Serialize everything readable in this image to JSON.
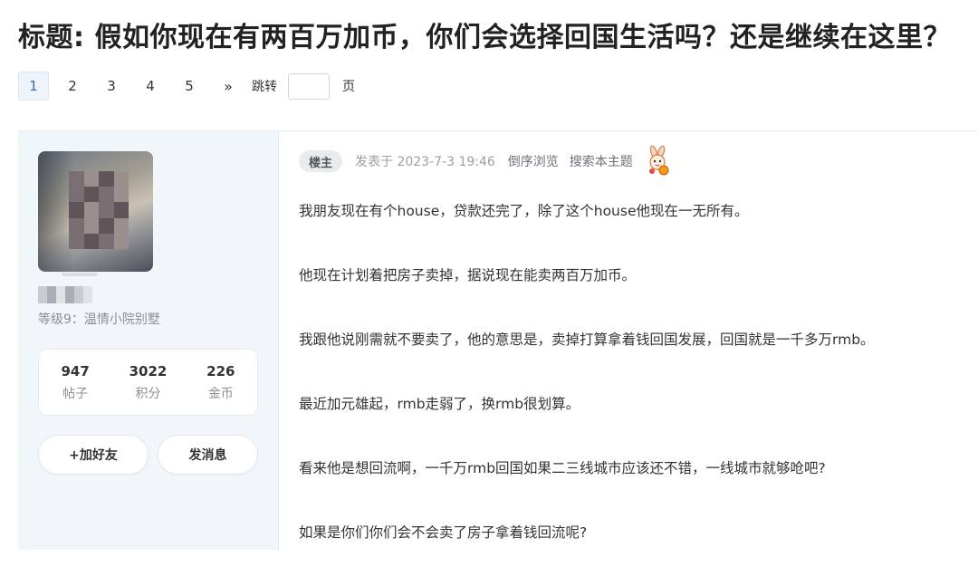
{
  "thread": {
    "title": "标题: 假如你现在有两百万加币，你们会选择回国生活吗？还是继续在这里？"
  },
  "pagination": {
    "pages": [
      "1",
      "2",
      "3",
      "4",
      "5"
    ],
    "current": "1",
    "next": "»",
    "jump_label": "跳转",
    "jump_value": "",
    "page_unit": "页"
  },
  "author": {
    "level": "等级9：温情小院别墅",
    "stats": [
      {
        "value": "947",
        "label": "帖子"
      },
      {
        "value": "3022",
        "label": "积分"
      },
      {
        "value": "226",
        "label": "金币"
      }
    ],
    "add_friend": "+加好友",
    "send_message": "发消息"
  },
  "post": {
    "owner_badge": "楼主",
    "posted_at": "发表于 2023-7-3 19:46",
    "reverse_view": "倒序浏览",
    "search_thread": "搜索本主题",
    "mascot_icon": "rabbit-mascot-icon",
    "paragraphs": [
      "我朋友现在有个house，贷款还完了，除了这个house他现在一无所有。",
      "他现在计划着把房子卖掉，据说现在能卖两百万加币。",
      "我跟他说刚需就不要卖了，他的意思是，卖掉打算拿着钱回国发展，回国就是一千多万rmb。",
      "最近加元雄起，rmb走弱了，换rmb很划算。",
      "看来他是想回流啊，一千万rmb回国如果二三线城市应该还不错，一线城市就够呛吧?",
      "如果是你们你们会不会卖了房子拿着钱回流呢?"
    ]
  },
  "colors": {
    "sidebar_bg": "#f0f6fa",
    "current_page_bg": "#eef4fb",
    "muted_text": "#9aa0a6"
  }
}
